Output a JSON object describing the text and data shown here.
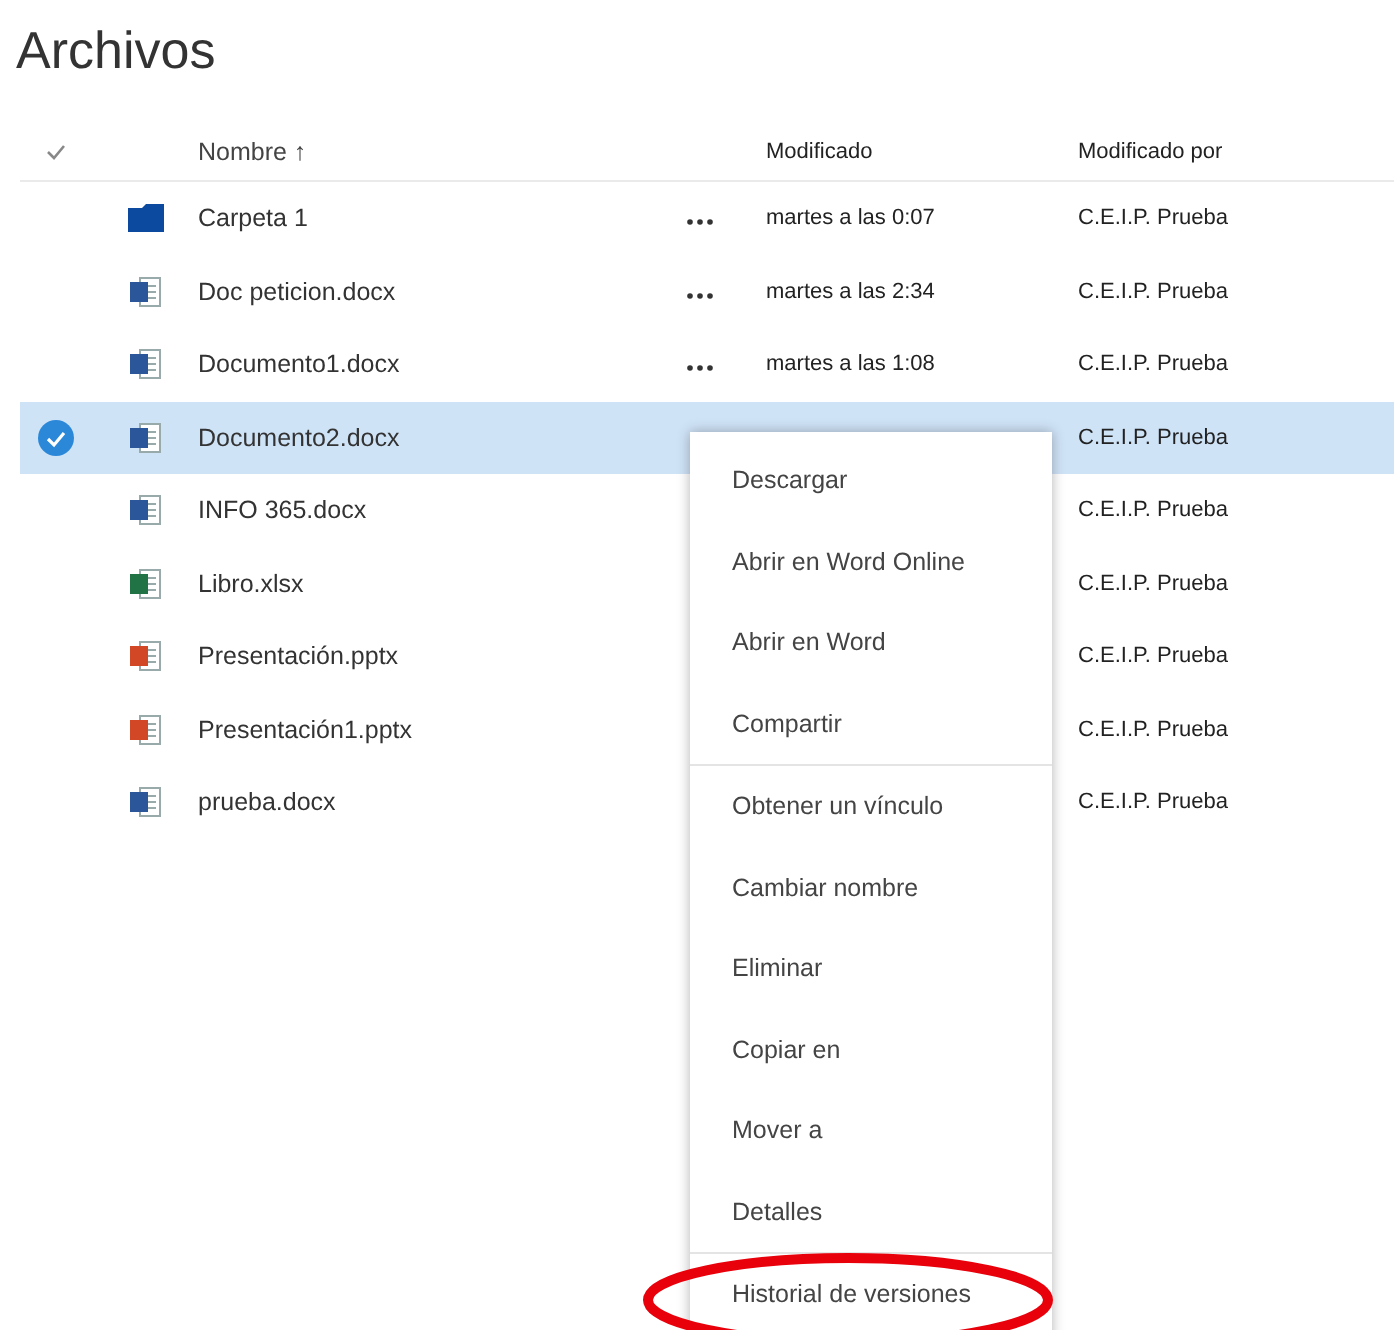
{
  "title": "Archivos",
  "columns": [
    {
      "label": "Nombre ↑"
    },
    {
      "label": "Modificado"
    },
    {
      "label": "Modificado por"
    }
  ],
  "rows": [
    {
      "kind": "folder",
      "name": "Carpeta 1",
      "modified": "martes a las 0:07",
      "modified_by": "C.E.I.P. Prueba",
      "selected": false
    },
    {
      "kind": "word",
      "name": "Doc peticion.docx",
      "modified": "martes a las 2:34",
      "modified_by": "C.E.I.P. Prueba",
      "selected": false
    },
    {
      "kind": "word",
      "name": "Documento1.docx",
      "modified": "martes a las 1:08",
      "modified_by": "C.E.I.P. Prueba",
      "selected": false
    },
    {
      "kind": "word",
      "name": "Documento2.docx",
      "modified_by": "C.E.I.P. Prueba",
      "selected": true
    },
    {
      "kind": "word",
      "name": "INFO 365.docx",
      "modified_by": "C.E.I.P. Prueba",
      "selected": false
    },
    {
      "kind": "excel",
      "name": "Libro.xlsx",
      "modified_by": "C.E.I.P. Prueba",
      "selected": false
    },
    {
      "kind": "powerpoint",
      "name": "Presentación.pptx",
      "modified_by": "C.E.I.P. Prueba",
      "selected": false
    },
    {
      "kind": "powerpoint",
      "name": "Presentación1.pptx",
      "modified_by": "C.E.I.P. Prueba",
      "selected": false
    },
    {
      "kind": "word",
      "name": "prueba.docx",
      "modified_by": "C.E.I.P. Prueba",
      "selected": false
    }
  ],
  "context_menu": [
    {
      "label": "Descargar",
      "divider_after": false,
      "highlighted": false
    },
    {
      "label": "Abrir en Word Online",
      "divider_after": false,
      "highlighted": false
    },
    {
      "label": "Abrir en Word",
      "divider_after": false,
      "highlighted": false
    },
    {
      "label": "Compartir",
      "divider_after": true,
      "highlighted": false
    },
    {
      "label": "Obtener un vínculo",
      "divider_after": false,
      "highlighted": false
    },
    {
      "label": "Cambiar nombre",
      "divider_after": false,
      "highlighted": false
    },
    {
      "label": "Eliminar",
      "divider_after": false,
      "highlighted": false
    },
    {
      "label": "Copiar en",
      "divider_after": false,
      "highlighted": false
    },
    {
      "label": "Mover a",
      "divider_after": false,
      "highlighted": false
    },
    {
      "label": "Detalles",
      "divider_after": true,
      "highlighted": false
    },
    {
      "label": "Historial de versiones",
      "divider_after": false,
      "highlighted": true
    }
  ]
}
